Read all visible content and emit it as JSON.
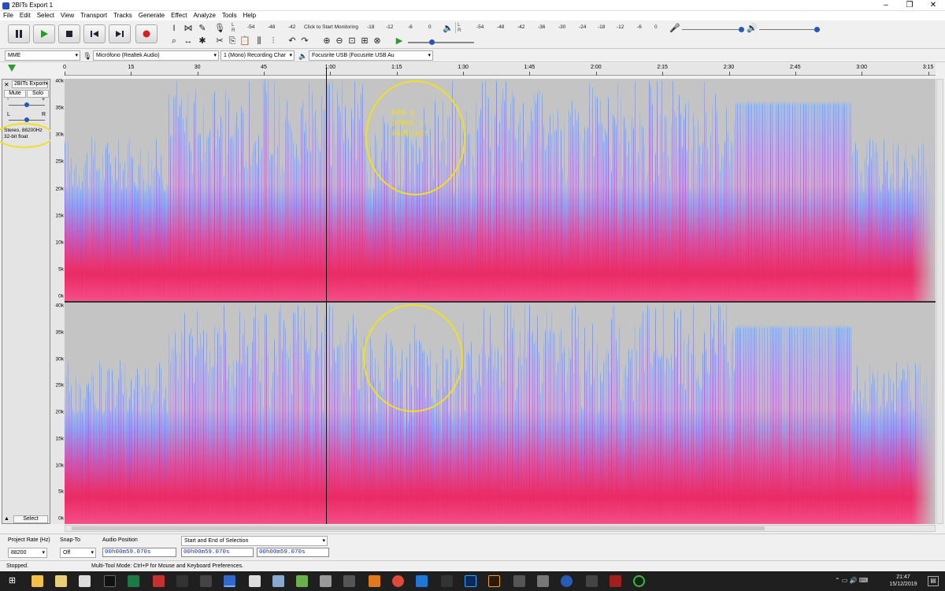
{
  "window": {
    "title": "2BITs Export 1"
  },
  "menu": [
    "File",
    "Edit",
    "Select",
    "View",
    "Transport",
    "Tracks",
    "Generate",
    "Effect",
    "Analyze",
    "Tools",
    "Help"
  ],
  "transport": {
    "pause": "pause-icon",
    "play": "play-icon",
    "stop": "stop-icon",
    "skip_start": "skip-start-icon",
    "skip_end": "skip-end-icon",
    "record": "record-icon"
  },
  "meters": {
    "record_scale": [
      "-54",
      "-48",
      "-42",
      "-18",
      "-12",
      "-6",
      "0"
    ],
    "monitor_hint": "Click to Start Monitoring",
    "play_scale": [
      "-54",
      "-48",
      "-42",
      "-36",
      "-30",
      "-24",
      "-18",
      "-12",
      "-6",
      "0"
    ]
  },
  "device": {
    "host": "MME",
    "input": "Micrófono (Realtek Audio)",
    "channels": "1 (Mono) Recording Char",
    "output": "Focusrite USB (Focusrite USB Au"
  },
  "timeline": [
    "0",
    "15",
    "30",
    "45",
    "1:00",
    "1:15",
    "1:30",
    "1:45",
    "2:00",
    "2:15",
    "2:30",
    "2:45",
    "3:00",
    "3:15"
  ],
  "track": {
    "name": "2BITs Export",
    "mute": "Mute",
    "solo": "Solo",
    "gain_minus": "-",
    "gain_plus": "+",
    "pan_l": "L",
    "pan_r": "R",
    "info_line1": "Stereo, 88200Hz",
    "info_line2": "32-bit float",
    "select": "Select"
  },
  "freq_labels": [
    "40k",
    "35k",
    "30k",
    "25k",
    "20k",
    "15k",
    "10k",
    "5k",
    "0k"
  ],
  "annotation": {
    "line1": "FPB a",
    "line2": "20KHz y",
    "line3": "48db/oct"
  },
  "selection_toolbar": {
    "rate_label": "Project Rate (Hz)",
    "rate_value": "88200",
    "snap_label": "Snap-To",
    "snap_value": "Off",
    "audio_pos_label": "Audio Position",
    "audio_pos_value": "00h00m59.070s",
    "sel_label": "Start and End of Selection",
    "sel_start": "00h00m59.070s",
    "sel_end": "00h00m59.070s"
  },
  "status": {
    "left": "Stopped.",
    "hint": "Multi-Tool Mode: Ctrl+P for Mouse and Keyboard Preferences."
  },
  "taskbar": {
    "time": "21:47",
    "date": "15/12/2019"
  },
  "colors": {
    "accent_yellow": "#f0e020",
    "spectrogram_gray": "#c4c4c4",
    "magenta": "#e8306e",
    "blue": "#6a9ef2"
  }
}
